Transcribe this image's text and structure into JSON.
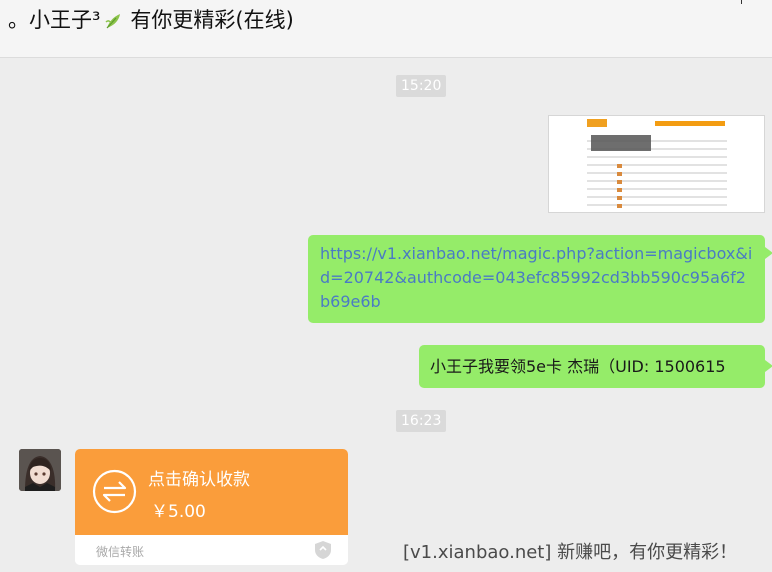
{
  "chat": {
    "title_name": "。小王子³",
    "title_tail": "有你更精彩(在线)",
    "leaf_icon": "leaf-icon"
  },
  "messages": {
    "time_1": "15:20",
    "link": "https://v1.xianbao.net/magic.php?action=magicbox&id=20742&authcode=043efc85992cd3bb590c95a6f2b69e6b",
    "text": "小王子我要领5e卡   杰瑞（UID: 1500615",
    "time_2": "16:23"
  },
  "transfer": {
    "title": "点击确认收款",
    "amount": "￥5.00",
    "source": "微信转账",
    "accent_color": "#fa9d3b",
    "icon": "transfer-icon",
    "shield_icon": "shield-icon"
  },
  "watermark": "[v1.xianbao.net] 新赚吧，有你更精彩！",
  "colors": {
    "sent_bubble": "#95ec69",
    "link_text": "#4a7bc4",
    "background": "#ededed"
  }
}
